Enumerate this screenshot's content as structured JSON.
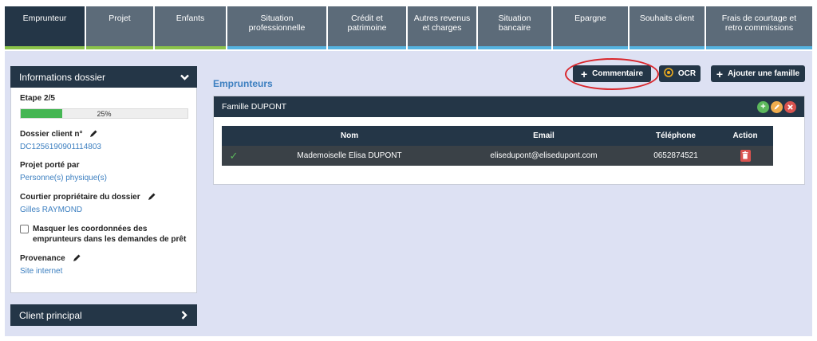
{
  "tabs": [
    {
      "label": "Emprunteur",
      "active": true,
      "underline": "green"
    },
    {
      "label": "Projet",
      "active": false,
      "underline": "green"
    },
    {
      "label": "Enfants",
      "active": false,
      "underline": "green"
    },
    {
      "label": "Situation\nprofessionnelle",
      "active": false,
      "underline": "blue"
    },
    {
      "label": "Crédit et\npatrimoine",
      "active": false,
      "underline": "blue"
    },
    {
      "label": "Autres revenus\net charges",
      "active": false,
      "underline": "blue"
    },
    {
      "label": "Situation\nbancaire",
      "active": false,
      "underline": "blue"
    },
    {
      "label": "Epargne",
      "active": false,
      "underline": "blue"
    },
    {
      "label": "Souhaits client",
      "active": false,
      "underline": "blue"
    },
    {
      "label": "Frais de courtage et\nretro commissions",
      "active": false,
      "underline": "blue"
    }
  ],
  "sidebar": {
    "info_title": "Informations dossier",
    "etape_label": "Etape 2/5",
    "progress_percent": 25,
    "progress_text": "25%",
    "dossier_label": "Dossier client n°",
    "dossier_value": "DC1256190901114803",
    "projet_label": "Projet porté par",
    "projet_value": "Personne(s) physique(s)",
    "courtier_label": "Courtier propriétaire du dossier",
    "courtier_value": "Gilles RAYMOND",
    "masquer_label": "Masquer les coordonnées des emprunteurs dans les demandes de prêt",
    "provenance_label": "Provenance",
    "provenance_value": "Site internet",
    "client_title": "Client principal"
  },
  "main": {
    "section_title": "Emprunteurs",
    "btn_comment": "Commentaire",
    "btn_ocr": "OCR",
    "btn_family": "Ajouter une famille",
    "family_title": "Famille DUPONT",
    "columns": [
      "",
      "Nom",
      "Email",
      "Téléphone",
      "Action"
    ],
    "rows": [
      {
        "name": "Mademoiselle Elisa DUPONT",
        "email": "elisedupont@elisedupont.com",
        "phone": "0652874521"
      }
    ]
  },
  "colors": {
    "nav_dark": "#243647",
    "tab_bg": "#5c6b79",
    "accent_green": "#8bc34a",
    "accent_blue": "#55b3e0",
    "link_blue": "#3c7fc0",
    "highlight_red": "#d9262c"
  }
}
